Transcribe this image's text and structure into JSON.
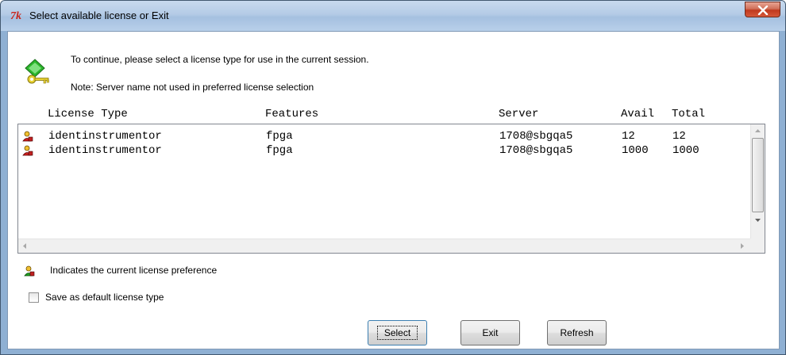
{
  "window": {
    "title": "Select available license or Exit",
    "close_label": "X"
  },
  "info": {
    "line1": "To continue, please select a license type for use in the current session.",
    "line2": "Note: Server name not used in preferred license selection"
  },
  "table": {
    "headers": {
      "license_type": "License Type",
      "features": "Features",
      "server": "Server",
      "avail": "Avail",
      "total": "Total"
    },
    "rows": [
      {
        "license_type": "identinstrumentor",
        "features": "fpga",
        "server": "1708@sbgqa5",
        "avail": "12",
        "total": "12"
      },
      {
        "license_type": "identinstrumentor",
        "features": "fpga",
        "server": "1708@sbgqa5",
        "avail": "1000",
        "total": "1000"
      }
    ]
  },
  "legend": {
    "text": "Indicates the current license preference"
  },
  "checkbox": {
    "label": "Save as default license type",
    "checked": false
  },
  "buttons": {
    "select": "Select",
    "exit": "Exit",
    "refresh": "Refresh"
  },
  "icons": {
    "app": "tcl-tk-icon",
    "key": "key-diamond-icon",
    "row": "license-user-icon",
    "legend": "preferred-license-icon"
  }
}
